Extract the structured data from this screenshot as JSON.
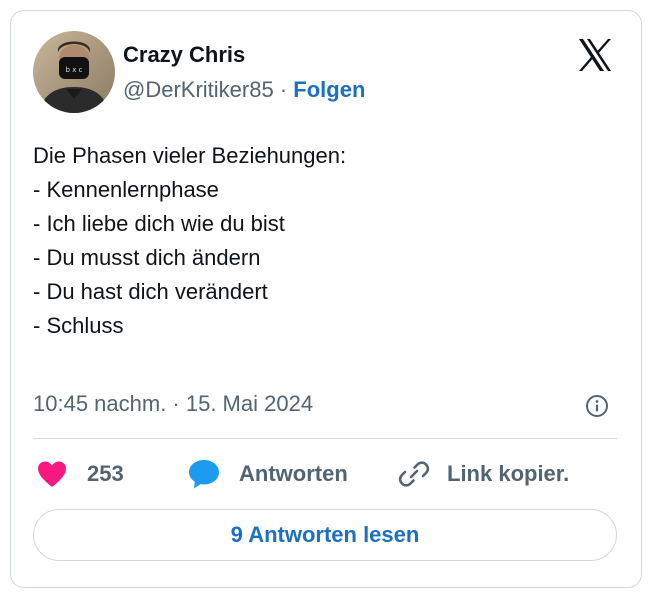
{
  "author": {
    "name": "Crazy Chris",
    "handle": "@DerKritiker85",
    "separator": "·",
    "follow_label": "Folgen"
  },
  "tweet": {
    "lines": [
      "Die Phasen vieler Beziehungen:",
      "",
      "- Kennenlernphase",
      "- Ich liebe dich wie du bist",
      "- Du musst dich ändern",
      "- Du hast dich verändert",
      "- Schluss"
    ],
    "timestamp": "10:45 nachm. · 15. Mai 2024"
  },
  "actions": {
    "likes_count": "253",
    "reply_label": "Antworten",
    "copy_link_label": "Link kopier."
  },
  "read_replies_label": "9 Antworten lesen",
  "icons": {
    "platform": "x-logo-icon",
    "info": "info-icon",
    "like": "heart-icon",
    "reply": "speech-bubble-icon",
    "link": "link-icon"
  },
  "colors": {
    "link_blue": "#1d6fc2",
    "heart_pink": "#f91880",
    "reply_blue": "#1d9bf0",
    "muted_gray": "#536471",
    "border": "#cfd9de"
  }
}
